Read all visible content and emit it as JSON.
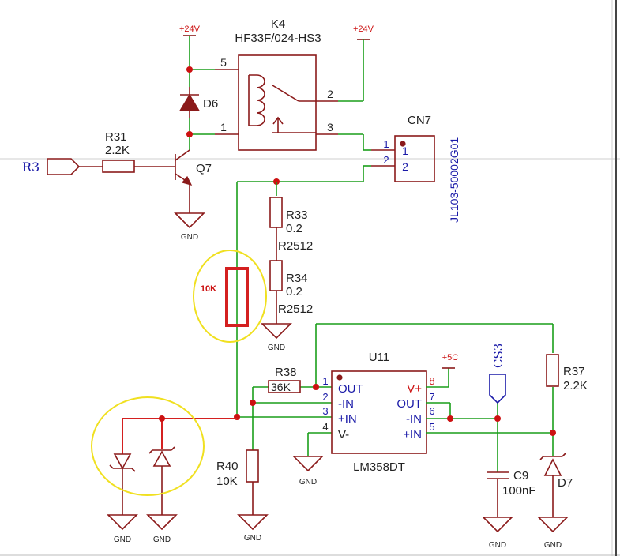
{
  "relay": {
    "ref": "K4",
    "part": "HF33F/024-HS3",
    "pins": [
      "5",
      "1",
      "2",
      "3"
    ]
  },
  "power": {
    "v24a": "+24V",
    "v24b": "+24V",
    "v5": "+5C"
  },
  "diode_d6": {
    "ref": "D6"
  },
  "transistor_q7": {
    "ref": "Q7"
  },
  "resistor_r31": {
    "ref": "R31",
    "value": "2.2K"
  },
  "net_r3": {
    "label": "R3"
  },
  "connector_cn7": {
    "ref": "CN7",
    "part": "JL103-50002G01",
    "pins": [
      "1",
      "2",
      "1",
      "2"
    ]
  },
  "resistor_r33": {
    "ref": "R33",
    "value": "0.2",
    "package": "R2512"
  },
  "resistor_r34": {
    "ref": "R34",
    "value": "0.2",
    "package": "R2512"
  },
  "annotation_10k": {
    "label": "10K"
  },
  "opamp_u11": {
    "ref": "U11",
    "part": "LM358DT",
    "pin_numbers": [
      "1",
      "2",
      "3",
      "4",
      "8",
      "7",
      "6",
      "5"
    ],
    "pin_names": [
      "OUT",
      "-IN",
      "+IN",
      "V-",
      "V+",
      "OUT",
      "-IN",
      "+IN"
    ]
  },
  "resistor_r38": {
    "ref": "R38",
    "value": "36K"
  },
  "resistor_r40": {
    "ref": "R40",
    "value": "10K"
  },
  "resistor_r37": {
    "ref": "R37",
    "value": "2.2K"
  },
  "net_cs3": {
    "label": "CS3"
  },
  "capacitor_c9": {
    "ref": "C9",
    "value": "100nF"
  },
  "zener_d7": {
    "ref": "D7"
  },
  "gnd_label": "GND",
  "colors": {
    "wire": "#1a9e1a",
    "component": "#8b1a1a",
    "pin_label": "#1a1aa8",
    "highlight": "#d42020",
    "circle": "#f0e020"
  }
}
